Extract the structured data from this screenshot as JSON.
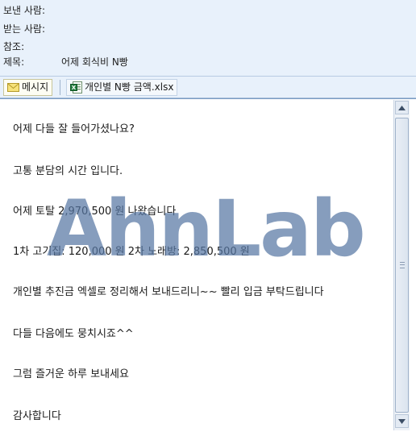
{
  "header": {
    "from_label": "보낸 사람:",
    "from_value": "",
    "to_label": "받는 사람:",
    "to_value": "",
    "cc_label": "참조:",
    "cc_value": "",
    "subject_label": "제목:",
    "subject_value": "어제 회식비 N빵"
  },
  "tabs": [
    {
      "label": "메시지",
      "icon": "envelope-icon"
    },
    {
      "label": "개인별 N빵 금액.xlsx",
      "icon": "excel-file-icon"
    }
  ],
  "body": {
    "lines": [
      "어제 다들 잘 들어가셨나요?",
      "고통 분담의 시간 입니다.",
      "어제 토탈 2,970,500 원 나왔습니다",
      "1차 고기집: 120,000 원 2차 노래방: 2,850,500 원",
      "개인별 추진금 엑셀로 정리해서 보내드리니~~ 빨리 입금 부탁드립니다",
      "다들 다음에도 뭉치시죠^^",
      "그럼 즐거운 하루 보내세요",
      "감사합니다"
    ]
  },
  "watermark": "AhnLab",
  "colors": {
    "header_bg": "#e8f1fb",
    "watermark": "#5878a4"
  }
}
